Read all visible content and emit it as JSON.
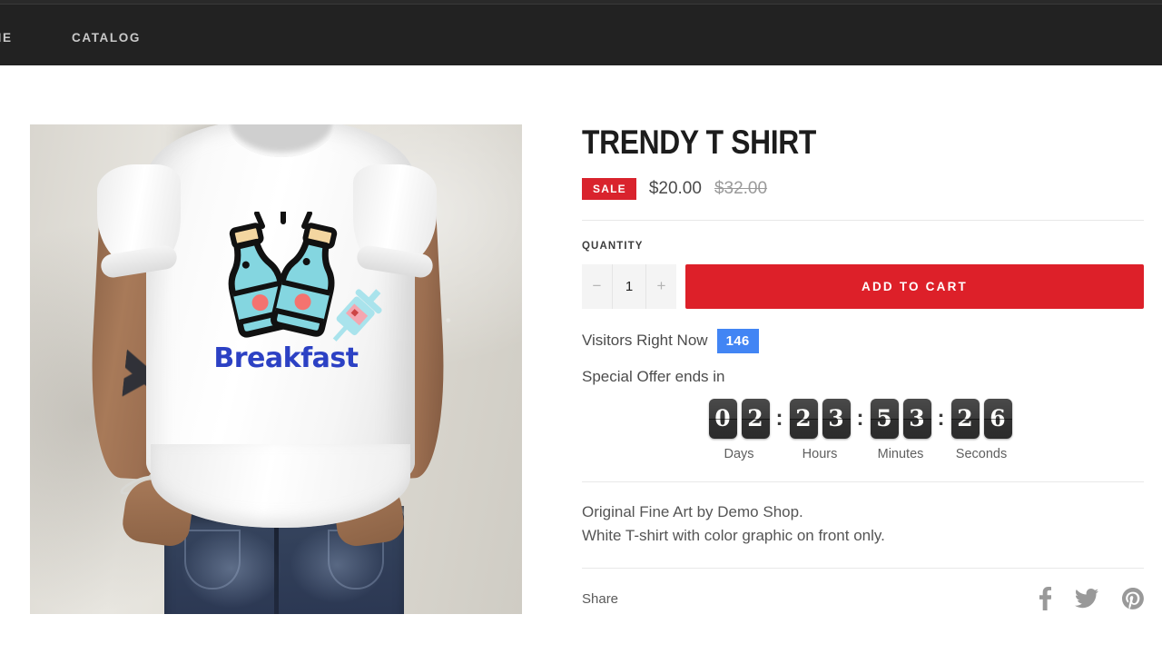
{
  "nav": {
    "items": [
      {
        "label": "HOME",
        "name": "nav-item-home",
        "truncated": "OME"
      },
      {
        "label": "CATALOG",
        "name": "nav-item-catalog"
      }
    ]
  },
  "product": {
    "title": "TRENDY T SHIRT",
    "badge": "SALE",
    "price_current": "$20.00",
    "price_compare": "$32.00",
    "image_alt": "Man wearing white Breakfast t-shirt against concrete wall",
    "graphic_text": "Breakfast"
  },
  "quantity": {
    "label": "QUANTITY",
    "decrement": "−",
    "value": "1",
    "increment": "+"
  },
  "cart": {
    "add_label": "ADD TO CART"
  },
  "visitors": {
    "text": "Visitors Right Now",
    "count": "146",
    "badge_color": "#4285f4"
  },
  "offer": {
    "text": "Special Offer ends in",
    "countdown": {
      "separator": ":",
      "groups": [
        {
          "label": "Days",
          "digits": [
            "0",
            "2"
          ]
        },
        {
          "label": "Hours",
          "digits": [
            "2",
            "3"
          ]
        },
        {
          "label": "Minutes",
          "digits": [
            "5",
            "3"
          ]
        },
        {
          "label": "Seconds",
          "digits": [
            "2",
            "6"
          ]
        }
      ]
    }
  },
  "description": {
    "line1": "Original Fine Art by Demo Shop.",
    "line2": "White T-shirt with color graphic on front only."
  },
  "share": {
    "label": "Share",
    "icons": [
      {
        "name": "facebook-icon",
        "title": "Facebook"
      },
      {
        "name": "twitter-icon",
        "title": "Twitter"
      },
      {
        "name": "pinterest-icon",
        "title": "Pinterest"
      }
    ]
  },
  "colors": {
    "nav_bg": "#222222",
    "accent_red": "#dd2029",
    "sale_red": "#d9232d",
    "visitor_blue": "#4285f4",
    "tile_dark": "#3a3a3a"
  }
}
